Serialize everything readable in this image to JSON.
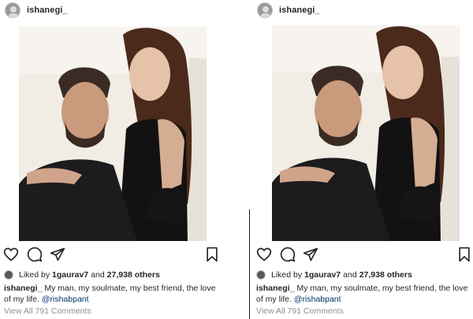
{
  "posts": [
    {
      "username": "ishanegi_",
      "actions": [
        "heart-icon",
        "comment-icon",
        "share-icon",
        "bookmark-icon"
      ],
      "liked_by_prefix": "Liked by",
      "liked_by_user": "1gaurav7",
      "liked_by_joiner": "and",
      "liked_by_count": "27,938 others",
      "caption_user": "ishanegi_",
      "caption_text": "My man, my soulmate, my best friend, the love of my life.",
      "caption_mention": "@rishabpant",
      "comments_link": "View All 791 Comments"
    },
    {
      "username": "ishanegi_",
      "actions": [
        "heart-icon",
        "comment-icon",
        "share-icon",
        "bookmark-icon"
      ],
      "liked_by_prefix": "Liked by",
      "liked_by_user": "1gaurav7",
      "liked_by_joiner": "and",
      "liked_by_count": "27,938 others",
      "caption_user": "ishanegi_",
      "caption_text": "My man, my soulmate, my best friend, the love of my life.",
      "caption_mention": "@rishabpant",
      "comments_link": "View All 791 Comments"
    }
  ],
  "colors": {
    "text": "#262626",
    "muted": "#8e8e8e",
    "mention": "#003569",
    "background": "#ffffff"
  }
}
